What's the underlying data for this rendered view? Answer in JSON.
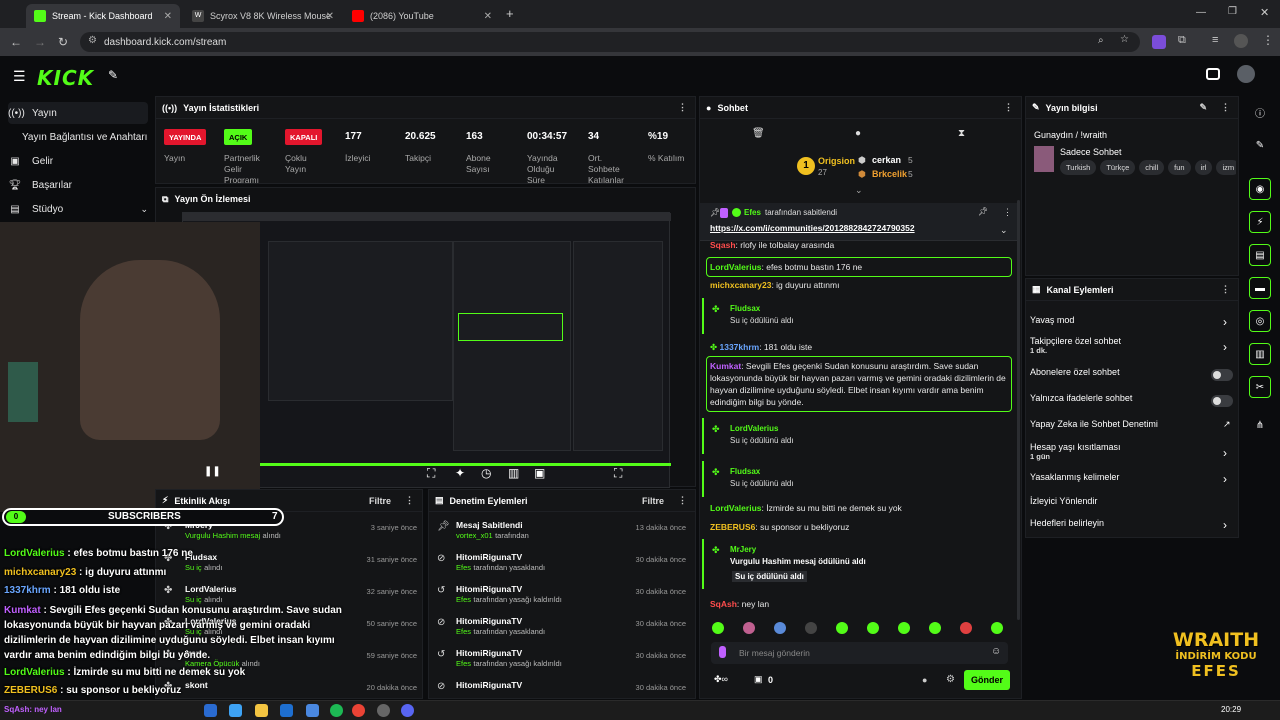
{
  "browser": {
    "tabs": [
      {
        "label": "Stream - Kick Dashboard",
        "color": "#53fc18"
      },
      {
        "label": "Scyrox V8 8K Wireless Mouse",
        "color": "#ffffff"
      },
      {
        "label": "(2086) YouTube",
        "color": "#ff0000"
      }
    ],
    "new_tab": "+",
    "url": "dashboard.kick.com/stream"
  },
  "brand": {
    "logo": "KICK",
    "accent": "#53fc18"
  },
  "sidebar": {
    "items": [
      {
        "label": "Yayın",
        "icon": "broadcast-icon"
      },
      {
        "label": "Yayın Bağlantısı ve Anahtarı",
        "icon": ""
      },
      {
        "label": "Gelir",
        "icon": "dollar-icon"
      },
      {
        "label": "Başarılar",
        "icon": "trophy-icon"
      },
      {
        "label": "Stüdyo",
        "icon": "studio-icon"
      }
    ]
  },
  "stats": {
    "title": "Yayın İstatistikleri",
    "badges": [
      {
        "value": "YAYINDA",
        "label": "Yayın",
        "bg": "#e3162d",
        "fg": "#ffffff"
      },
      {
        "value": "AÇIK",
        "label": "Partnerlik Gelir Programı",
        "bg": "#53fc18",
        "fg": "#000000"
      },
      {
        "value": "KAPALI",
        "label": "Çoklu Yayın",
        "bg": "#e3162d",
        "fg": "#ffffff"
      }
    ],
    "numbers": [
      {
        "value": "177",
        "label": "İzleyici"
      },
      {
        "value": "20.625",
        "label": "Takipçi"
      },
      {
        "value": "163",
        "label": "Abone Sayısı"
      },
      {
        "value": "00:34:57",
        "label": "Yayında Olduğu Süre"
      },
      {
        "value": "34",
        "label": "Ort. Sohbete Katılanlar"
      },
      {
        "value": "%19",
        "label": "% Katılım"
      }
    ]
  },
  "preview": {
    "title": "Yayın Ön İzlemesi"
  },
  "activity": {
    "title": "Etkinlik Akışı",
    "filter": "Filtre",
    "items": [
      {
        "name": "MrJery",
        "sub": "Vurgulu Hashim mesaj",
        "action": "alındı",
        "time": "3 saniye önce"
      },
      {
        "name": "Fludsax",
        "sub": "Su iç",
        "action": "alındı",
        "time": "31 saniye önce"
      },
      {
        "name": "LordValerius",
        "sub": "Su iç",
        "action": "alındı",
        "time": "32 saniye önce"
      },
      {
        "name": "LordValerius",
        "sub": "Su iç",
        "action": "alındı",
        "time": "50 saniye önce"
      },
      {
        "name": "fren",
        "sub": "Kamera Öpücük",
        "action": "alındı",
        "time": "59 saniye önce"
      },
      {
        "name": "skont",
        "sub": "",
        "action": "",
        "time": "20 dakika önce"
      }
    ]
  },
  "moderation": {
    "title": "Denetim Eylemleri",
    "filter": "Filtre",
    "items": [
      {
        "name": "Mesaj Sabitlendi",
        "by": "vortex_x01",
        "action": "tarafından",
        "time": "13 dakika önce",
        "icon": "pin-icon"
      },
      {
        "name": "HitomiRigunaTV",
        "by": "Efes",
        "action": "tarafından yasaklandı",
        "time": "30 dakika önce",
        "icon": "ban-icon"
      },
      {
        "name": "HitomiRigunaTV",
        "by": "Efes",
        "action": "tarafından yasağı kaldırıldı",
        "time": "30 dakika önce",
        "icon": "undo-icon"
      },
      {
        "name": "HitomiRigunaTV",
        "by": "Efes",
        "action": "tarafından yasaklandı",
        "time": "30 dakika önce",
        "icon": "ban-icon"
      },
      {
        "name": "HitomiRigunaTV",
        "by": "Efes",
        "action": "tarafından yasağı kaldırıldı",
        "time": "30 dakika önce",
        "icon": "undo-icon"
      },
      {
        "name": "HitomiRigunaTV",
        "by": "",
        "action": "",
        "time": "30 dakika önce",
        "icon": "ban-icon"
      }
    ]
  },
  "chat": {
    "title": "Sohbet",
    "leaders": {
      "first": {
        "name": "Origsion",
        "count": "27"
      },
      "second": {
        "name": "cerkan",
        "count": "5"
      },
      "third": {
        "name": "Brkcelik",
        "count": "5"
      }
    },
    "pinned": {
      "by": "Efes",
      "label": "tarafından sabitlendi",
      "link": "https://x.com/i/communities/2012882842724790352"
    },
    "partial_top": {
      "user": "Sqash",
      "text": ": rlofy ile tolbalay arasında"
    },
    "messages": [
      {
        "user": "LordValerius",
        "text": ": efes botmu bastın 176 ne"
      },
      {
        "user": "michxcanary23",
        "text": ": ig duyuru attınmı"
      },
      {
        "user": "Fludsax",
        "text": "Su iç ödülünü aldı"
      },
      {
        "user": "1337khrm",
        "text": ": 181 oldu iste"
      },
      {
        "user": "Kumkat",
        "text": ": Sevgili Efes geçenki Sudan konusunu araştırdım. Save sudan lokasyonunda büyük bir hayvan pazarı varmış ve gemini oradaki dizilimlerin de hayvan dizilimine uyduğunu söyledi. Elbet insan kıyımı vardır ama benim edindiğim bilgi bu yönde."
      },
      {
        "user": "LordValerius",
        "text": "Su iç ödülünü aldı"
      },
      {
        "user": "Fludsax",
        "text": "Su iç ödülünü aldı"
      },
      {
        "user": "LordValerius",
        "text": ": İzmirde su mu bitti ne demek su yok"
      },
      {
        "user": "ZEBERUS6",
        "text": ": su sponsor u bekliyoruz"
      },
      {
        "user": "MrJery",
        "text": "Vurgulu Hashim mesaj ödülünü aldı",
        "extra": "Su iç ödülünü aldı"
      },
      {
        "user": "SqAsh",
        "text": ": ney lan"
      }
    ],
    "input_placeholder": "Bir mesaj gönderin",
    "points": "0",
    "send": "Gönder"
  },
  "stream_info": {
    "title": "Yayın bilgisi",
    "stream_title": "Gunaydın / !wraith",
    "category": "Sadece Sohbet",
    "tags": [
      "Turkish",
      "Türkçe",
      "chill",
      "fun",
      "irl",
      "izm"
    ]
  },
  "channel_actions": {
    "title": "Kanal Eylemleri",
    "items": [
      {
        "label": "Yavaş mod",
        "sub": "",
        "control": "arrow"
      },
      {
        "label": "Takipçilere özel sohbet",
        "sub": "1 dk.",
        "control": "arrow"
      },
      {
        "label": "Abonelere özel sohbet",
        "sub": "",
        "control": "toggle"
      },
      {
        "label": "Yalnızca ifadelerle sohbet",
        "sub": "",
        "control": "toggle"
      },
      {
        "label": "Yapay Zeka ile Sohbet Denetimi",
        "sub": "",
        "control": "external"
      },
      {
        "label": "Hesap yaşı kısıtlaması",
        "sub": "1 gün",
        "control": "arrow"
      },
      {
        "label": "Yasaklanmış kelimeler",
        "sub": "",
        "control": "arrow"
      },
      {
        "label": "İzleyici Yönlendir",
        "sub": "",
        "control": ""
      },
      {
        "label": "Hedefleri belirleyin",
        "sub": "",
        "control": "arrow"
      }
    ]
  },
  "overlay": {
    "subs_label": "SUBSCRIBERS",
    "subs_left": "0",
    "subs_right": "7",
    "lines": [
      {
        "user": "LordValerius",
        "text": " : efes botmu bastın 176 ne",
        "color": "#53fc18"
      },
      {
        "user": "michxcanary23",
        "text": " : ig duyuru attınmı",
        "color": "#f0c020"
      },
      {
        "user": "1337khrm",
        "text": " : 181 oldu iste",
        "color": "#6aa6ff"
      },
      {
        "user": "Kumkat",
        "text": " : Sevgili Efes geçenki Sudan konusunu araştırdım. Save sudan lokasyonunda büyük bir hayvan pazarı varmış ve gemini oradaki dizilimlerin de hayvan dizilimine uyduğunu söyledi. Elbet insan kıyımı vardır ama benim edindiğim bilgi bu yönde.",
        "color": "#c060ff"
      },
      {
        "user": "LordValerius",
        "text": " : İzmirde su mu bitti ne demek su yok",
        "color": "#53fc18"
      },
      {
        "user": "ZEBERUS6",
        "text": " : su sponsor u bekliyoruz",
        "color": "#f0c020"
      }
    ],
    "sponsor": {
      "line1": "WRAITH",
      "line2": "İNDİRİM KODU",
      "line3": "EFES"
    },
    "sqash": "SqAsh: ney lan"
  },
  "taskbar": {
    "time": "20:29"
  }
}
